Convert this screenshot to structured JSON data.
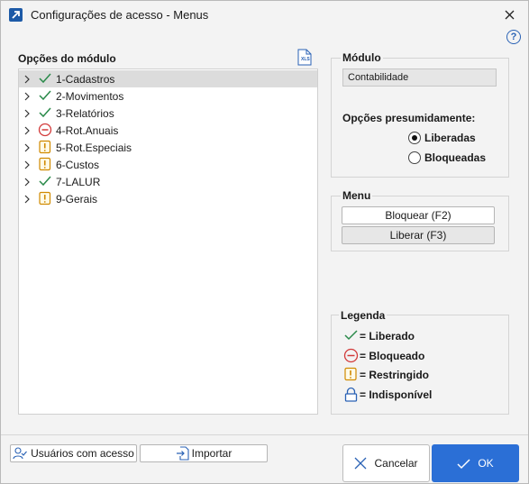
{
  "window": {
    "title": "Configurações de acesso - Menus"
  },
  "left": {
    "heading": "Opções do módulo",
    "xls_icon_text": "XLS",
    "rows": [
      {
        "label": "1-Cadastros",
        "status": "check",
        "selected": true
      },
      {
        "label": "2-Movimentos",
        "status": "check",
        "selected": false
      },
      {
        "label": "3-Relatórios",
        "status": "check",
        "selected": false
      },
      {
        "label": "4-Rot.Anuais",
        "status": "blocked",
        "selected": false
      },
      {
        "label": "5-Rot.Especiais",
        "status": "restricted",
        "selected": false
      },
      {
        "label": "6-Custos",
        "status": "restricted",
        "selected": false
      },
      {
        "label": "7-LALUR",
        "status": "check",
        "selected": false
      },
      {
        "label": "9-Gerais",
        "status": "restricted",
        "selected": false
      }
    ]
  },
  "modulo": {
    "heading": "Módulo",
    "value": "Contabilidade",
    "options_heading": "Opções presumidamente:",
    "opt_liberadas": "Liberadas",
    "opt_bloqueadas": "Bloqueadas",
    "selected": "Liberadas"
  },
  "menu": {
    "heading": "Menu",
    "bloquear": "Bloquear (F2)",
    "liberar": "Liberar (F3)"
  },
  "legenda": {
    "heading": "Legenda",
    "liberado": "= Liberado",
    "bloqueado": "= Bloqueado",
    "restringido": "= Restringido",
    "indisponivel": "= Indisponível"
  },
  "footer": {
    "usuarios": "Usuários com acesso",
    "importar": "Importar",
    "cancelar": "Cancelar",
    "ok": "OK"
  },
  "colors": {
    "check": "#2a8a4a",
    "blocked": "#d23a3a",
    "restricted": "#d08a00",
    "accent": "#2b6fd6",
    "unavailable": "#2a62b5"
  }
}
